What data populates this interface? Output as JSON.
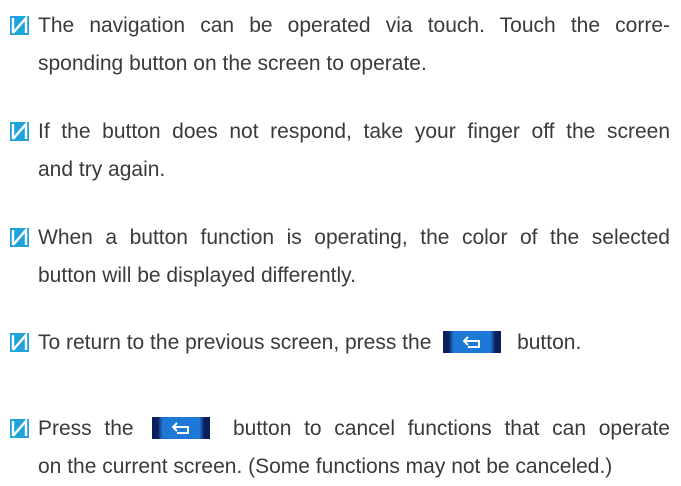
{
  "notes": [
    {
      "lines": [
        "The navigation can be operated via touch. Touch the corre-",
        "sponding button on the screen to operate."
      ]
    },
    {
      "lines": [
        "If the button does not respond, take your finger off the screen",
        "and try again."
      ]
    },
    {
      "lines": [
        "When a button function is operating, the color of the selected",
        "button will be displayed differently."
      ]
    },
    {
      "before": "To return to the previous screen, press the",
      "after": "button."
    },
    {
      "before": "Press the",
      "after": "button to cancel functions that can operate",
      "line2": "on the current screen. (Some functions may not be canceled.)"
    }
  ],
  "icons": {
    "bullet": "note-bullet-icon",
    "back": "back-arrow-icon"
  },
  "colors": {
    "bullet": "#1ea3dc",
    "button_fill": "#1e78d6",
    "button_edge": "#0d1f5b",
    "text": "#3a3a3a"
  }
}
